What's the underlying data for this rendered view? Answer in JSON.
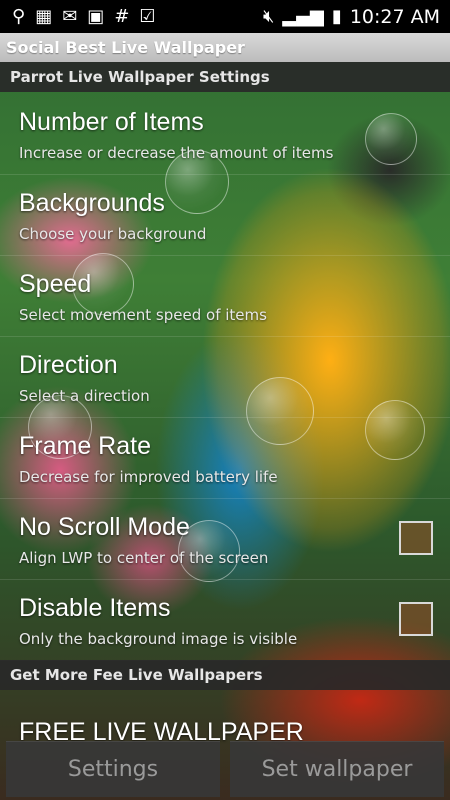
{
  "status_bar": {
    "left_icons": [
      "usb-icon",
      "sim-icon",
      "gmail-icon",
      "calendar-icon",
      "hash-icon",
      "clipboard-check-icon"
    ],
    "right_icons": [
      "mute-icon",
      "signal-icon",
      "battery-charging-icon"
    ],
    "time": "10:27 AM"
  },
  "title_bar": {
    "title": "Social Best Live Wallpaper"
  },
  "settings": {
    "header": "Parrot Live Wallpaper Settings",
    "items": [
      {
        "title": "Number of Items",
        "subtitle": "Increase or decrease the amount of items"
      },
      {
        "title": "Backgrounds",
        "subtitle": "Choose your background"
      },
      {
        "title": "Speed",
        "subtitle": "Select movement speed of items"
      },
      {
        "title": "Direction",
        "subtitle": "Select a direction"
      },
      {
        "title": "Frame Rate",
        "subtitle": "Decrease for improved battery life"
      },
      {
        "title": "No Scroll Mode",
        "subtitle": "Align LWP to center of the screen",
        "checked": false
      },
      {
        "title": "Disable Items",
        "subtitle": "Only the background image is visible",
        "checked": false
      }
    ]
  },
  "more": {
    "header": "Get More Fee Live Wallpapers",
    "item_title": "FREE LIVE WALLPAPER"
  },
  "buttons": {
    "settings_label": "Settings",
    "set_wallpaper_label": "Set wallpaper"
  }
}
